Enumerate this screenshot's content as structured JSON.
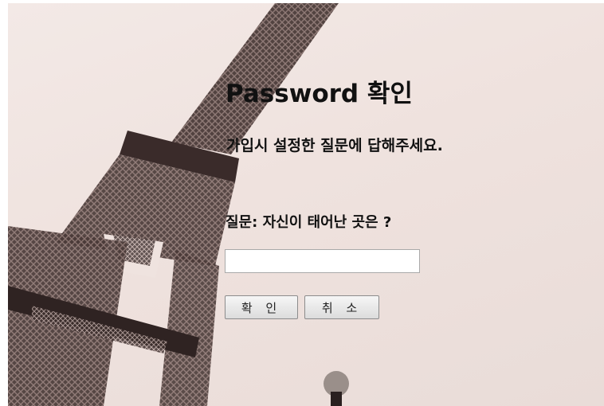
{
  "page": {
    "title": "Password 확인",
    "subtitle": "가입시 설정한 질문에 답해주세요.",
    "question": "질문: 자신이 태어난 곳은 ?"
  },
  "form": {
    "answer_value": "",
    "confirm_label": "확 인",
    "cancel_label": "취 소"
  },
  "background": {
    "subject": "eiffel-tower-photo"
  }
}
